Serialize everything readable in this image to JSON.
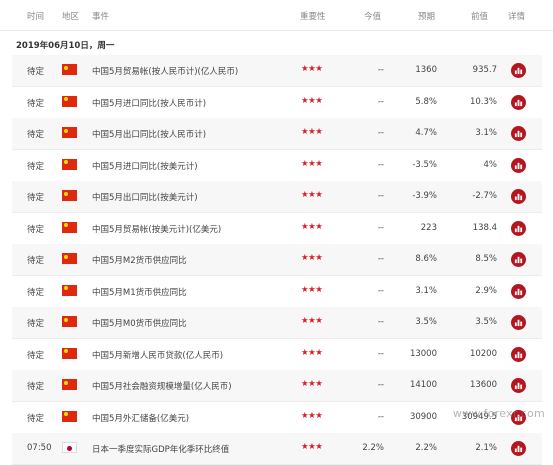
{
  "header": {
    "time": "时间",
    "region": "地区",
    "event": "事件",
    "importance": "重要性",
    "actual": "今值",
    "forecast": "预期",
    "previous": "前值",
    "detail": "详情"
  },
  "date_label": "2019年06月10日，周一",
  "rows": [
    {
      "time": "待定",
      "country": "china-flag",
      "event": "中国5月贸易帐(按人民币计)(亿人民币)",
      "stars": "★★★",
      "actual": "--",
      "forecast": "1360",
      "previous": "935.7"
    },
    {
      "time": "待定",
      "country": "china-flag",
      "event": "中国5月进口同比(按人民币计)",
      "stars": "★★★",
      "actual": "--",
      "forecast": "5.8%",
      "previous": "10.3%"
    },
    {
      "time": "待定",
      "country": "china-flag",
      "event": "中国5月出口同比(按人民币计)",
      "stars": "★★★",
      "actual": "--",
      "forecast": "4.7%",
      "previous": "3.1%"
    },
    {
      "time": "待定",
      "country": "china-flag",
      "event": "中国5月进口同比(按美元计)",
      "stars": "★★★",
      "actual": "--",
      "forecast": "-3.5%",
      "previous": "4%"
    },
    {
      "time": "待定",
      "country": "china-flag",
      "event": "中国5月出口同比(按美元计)",
      "stars": "★★★",
      "actual": "--",
      "forecast": "-3.9%",
      "previous": "-2.7%"
    },
    {
      "time": "待定",
      "country": "china-flag",
      "event": "中国5月贸易帐(按美元计)(亿美元)",
      "stars": "★★★",
      "actual": "--",
      "forecast": "223",
      "previous": "138.4"
    },
    {
      "time": "待定",
      "country": "china-flag",
      "event": "中国5月M2货币供应同比",
      "stars": "★★★",
      "actual": "--",
      "forecast": "8.6%",
      "previous": "8.5%"
    },
    {
      "time": "待定",
      "country": "china-flag",
      "event": "中国5月M1货币供应同比",
      "stars": "★★★",
      "actual": "--",
      "forecast": "3.1%",
      "previous": "2.9%"
    },
    {
      "time": "待定",
      "country": "china-flag",
      "event": "中国5月M0货币供应同比",
      "stars": "★★★",
      "actual": "--",
      "forecast": "3.5%",
      "previous": "3.5%"
    },
    {
      "time": "待定",
      "country": "china-flag",
      "event": "中国5月新增人民币贷款(亿人民币)",
      "stars": "★★★",
      "actual": "--",
      "forecast": "13000",
      "previous": "10200"
    },
    {
      "time": "待定",
      "country": "china-flag",
      "event": "中国5月社会融资规模增量(亿人民币)",
      "stars": "★★★",
      "actual": "--",
      "forecast": "14100",
      "previous": "13600"
    },
    {
      "time": "待定",
      "country": "china-flag",
      "event": "中国5月外汇储备(亿美元)",
      "stars": "★★★",
      "actual": "--",
      "forecast": "30900",
      "previous": "30949.5"
    },
    {
      "time": "07:50",
      "country": "japan-flag",
      "event": "日本一季度实际GDP年化季环比终值",
      "stars": "★★★",
      "actual": "2.2%",
      "forecast": "2.2%",
      "previous": "2.1%"
    }
  ],
  "watermark": "www.forexr.com",
  "colors": {
    "accent": "#d81e26",
    "detail_button": "#b4161f",
    "row_alt": "#f7f7f7"
  },
  "icons": {
    "detail": "bar-chart-icon"
  }
}
